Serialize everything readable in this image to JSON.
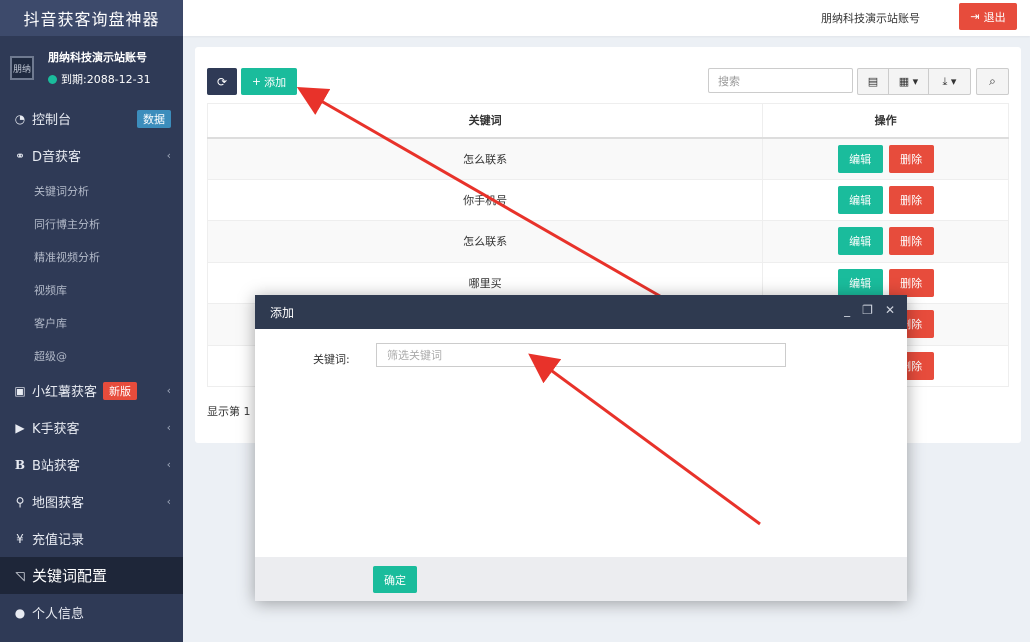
{
  "app": {
    "title": "抖音获客询盘神器"
  },
  "user": {
    "avatar_text": "朋纳",
    "name": "朋纳科技演示站账号",
    "expire": "到期:2088-12-31"
  },
  "sidebar": {
    "items": [
      {
        "label": "控制台",
        "badge": "数据"
      },
      {
        "label": "D音获客"
      },
      {
        "label": "关键词分析"
      },
      {
        "label": "同行博主分析"
      },
      {
        "label": "精准视频分析"
      },
      {
        "label": "视频库"
      },
      {
        "label": "客户库"
      },
      {
        "label": "超级@"
      },
      {
        "label": "小红薯获客",
        "badge": "新版"
      },
      {
        "label": "K手获客"
      },
      {
        "label": "B站获客"
      },
      {
        "label": "地图获客"
      },
      {
        "label": "充值记录"
      },
      {
        "label": "关键词配置"
      },
      {
        "label": "个人信息"
      }
    ]
  },
  "header": {
    "account": "朋纳科技演示站账号",
    "logout": "退出"
  },
  "toolbar": {
    "add": "添加",
    "search_placeholder": "搜索"
  },
  "table": {
    "headers": [
      "关键词",
      "操作"
    ],
    "rows": [
      {
        "keyword": "怎么联系"
      },
      {
        "keyword": "你手机号"
      },
      {
        "keyword": "怎么联系"
      },
      {
        "keyword": "哪里买"
      },
      {
        "keyword": ""
      },
      {
        "keyword": ""
      }
    ],
    "edit_label": "编辑",
    "delete_label": "删除",
    "footer": "显示第 1"
  },
  "modal": {
    "title": "添加",
    "field_label": "关键词:",
    "field_placeholder": "筛选关键词",
    "confirm": "确定"
  },
  "colors": {
    "sidebar": "#2f3a56",
    "accent": "#1abc9c",
    "danger": "#e74c3c",
    "arrow": "#e8322a"
  }
}
